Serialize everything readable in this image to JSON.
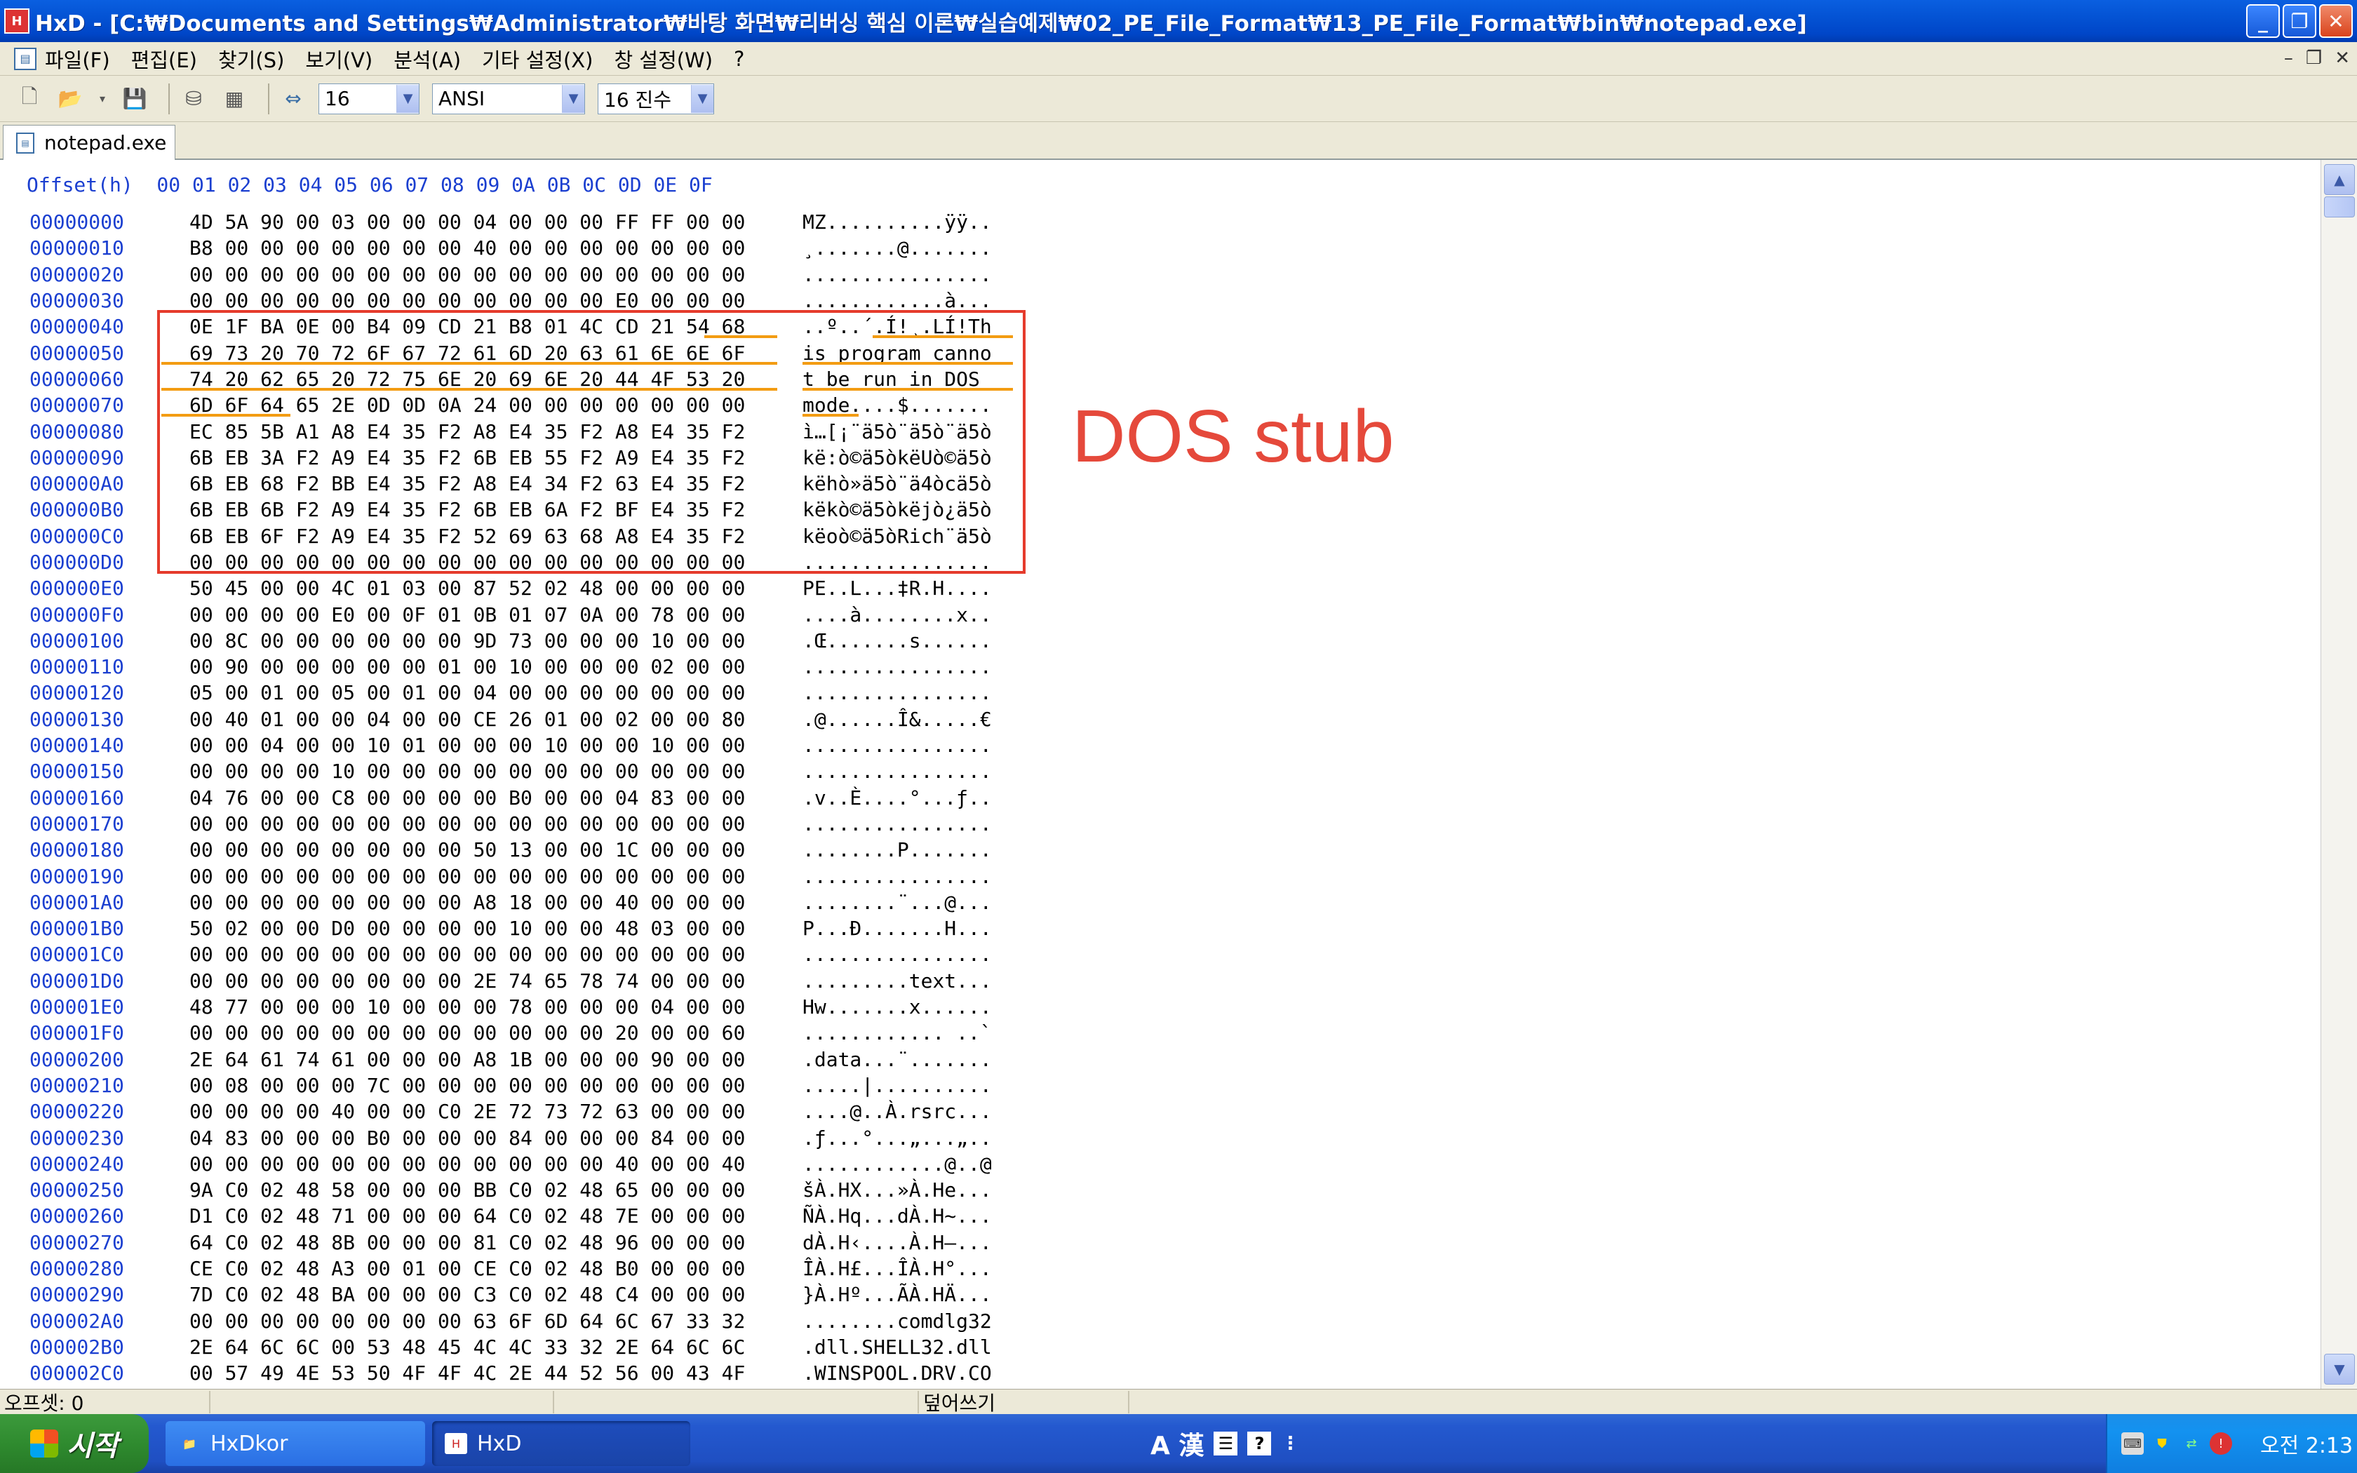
{
  "window": {
    "title": "HxD - [C:₩Documents and Settings₩Administrator₩바탕 화면₩리버싱 핵심 이론₩실습예제₩02_PE_File_Format₩13_PE_File_Format₩bin₩notepad.exe]",
    "app_icon_label": "H"
  },
  "menu": {
    "items": [
      "파일(F)",
      "편집(E)",
      "찾기(S)",
      "보기(V)",
      "분석(A)",
      "기타 설정(X)",
      "창 설정(W)",
      "?"
    ]
  },
  "toolbar": {
    "bytes_per_row": "16",
    "charset": "ANSI",
    "offset_base": "16 진수"
  },
  "tab": {
    "label": "notepad.exe"
  },
  "hex_header": "Offset(h)  00 01 02 03 04 05 06 07 08 09 0A 0B 0C 0D 0E 0F",
  "rows": [
    {
      "off": "00000000",
      "hex": "4D 5A 90 00 03 00 00 00 04 00 00 00 FF FF 00 00",
      "asc": "MZ..........ÿÿ.."
    },
    {
      "off": "00000010",
      "hex": "B8 00 00 00 00 00 00 00 40 00 00 00 00 00 00 00",
      "asc": "¸.......@......."
    },
    {
      "off": "00000020",
      "hex": "00 00 00 00 00 00 00 00 00 00 00 00 00 00 00 00",
      "asc": "................"
    },
    {
      "off": "00000030",
      "hex": "00 00 00 00 00 00 00 00 00 00 00 00 E0 00 00 00",
      "asc": "............à..."
    },
    {
      "off": "00000040",
      "hex": "0E 1F BA 0E 00 B4 09 CD 21 B8 01 4C CD 21 54 68",
      "asc": "..º..´.Í!¸.LÍ!Th"
    },
    {
      "off": "00000050",
      "hex": "69 73 20 70 72 6F 67 72 61 6D 20 63 61 6E 6E 6F",
      "asc": "is program canno"
    },
    {
      "off": "00000060",
      "hex": "74 20 62 65 20 72 75 6E 20 69 6E 20 44 4F 53 20",
      "asc": "t be run in DOS "
    },
    {
      "off": "00000070",
      "hex": "6D 6F 64 65 2E 0D 0D 0A 24 00 00 00 00 00 00 00",
      "asc": "mode....$......."
    },
    {
      "off": "00000080",
      "hex": "EC 85 5B A1 A8 E4 35 F2 A8 E4 35 F2 A8 E4 35 F2",
      "asc": "ì…[¡¨ä5ò¨ä5ò¨ä5ò"
    },
    {
      "off": "00000090",
      "hex": "6B EB 3A F2 A9 E4 35 F2 6B EB 55 F2 A9 E4 35 F2",
      "asc": "kë:ò©ä5òkëUò©ä5ò"
    },
    {
      "off": "000000A0",
      "hex": "6B EB 68 F2 BB E4 35 F2 A8 E4 34 F2 63 E4 35 F2",
      "asc": "këhò»ä5ò¨ä4òcä5ò"
    },
    {
      "off": "000000B0",
      "hex": "6B EB 6B F2 A9 E4 35 F2 6B EB 6A F2 BF E4 35 F2",
      "asc": "këkò©ä5òkëjò¿ä5ò"
    },
    {
      "off": "000000C0",
      "hex": "6B EB 6F F2 A9 E4 35 F2 52 69 63 68 A8 E4 35 F2",
      "asc": "këoò©ä5òRich¨ä5ò"
    },
    {
      "off": "000000D0",
      "hex": "00 00 00 00 00 00 00 00 00 00 00 00 00 00 00 00",
      "asc": "................"
    },
    {
      "off": "000000E0",
      "hex": "50 45 00 00 4C 01 03 00 87 52 02 48 00 00 00 00",
      "asc": "PE..L...‡R.H...."
    },
    {
      "off": "000000F0",
      "hex": "00 00 00 00 E0 00 0F 01 0B 01 07 0A 00 78 00 00",
      "asc": "....à........x.."
    },
    {
      "off": "00000100",
      "hex": "00 8C 00 00 00 00 00 00 9D 73 00 00 00 10 00 00",
      "asc": ".Œ.......s......"
    },
    {
      "off": "00000110",
      "hex": "00 90 00 00 00 00 00 01 00 10 00 00 00 02 00 00",
      "asc": "................"
    },
    {
      "off": "00000120",
      "hex": "05 00 01 00 05 00 01 00 04 00 00 00 00 00 00 00",
      "asc": "................"
    },
    {
      "off": "00000130",
      "hex": "00 40 01 00 00 04 00 00 CE 26 01 00 02 00 00 80",
      "asc": ".@......Î&.....€"
    },
    {
      "off": "00000140",
      "hex": "00 00 04 00 00 10 01 00 00 00 10 00 00 10 00 00",
      "asc": "................"
    },
    {
      "off": "00000150",
      "hex": "00 00 00 00 10 00 00 00 00 00 00 00 00 00 00 00",
      "asc": "................"
    },
    {
      "off": "00000160",
      "hex": "04 76 00 00 C8 00 00 00 00 B0 00 00 04 83 00 00",
      "asc": ".v..È....°...ƒ.."
    },
    {
      "off": "00000170",
      "hex": "00 00 00 00 00 00 00 00 00 00 00 00 00 00 00 00",
      "asc": "................"
    },
    {
      "off": "00000180",
      "hex": "00 00 00 00 00 00 00 00 50 13 00 00 1C 00 00 00",
      "asc": "........P......."
    },
    {
      "off": "00000190",
      "hex": "00 00 00 00 00 00 00 00 00 00 00 00 00 00 00 00",
      "asc": "................"
    },
    {
      "off": "000001A0",
      "hex": "00 00 00 00 00 00 00 00 A8 18 00 00 40 00 00 00",
      "asc": "........¨...@..."
    },
    {
      "off": "000001B0",
      "hex": "50 02 00 00 D0 00 00 00 00 10 00 00 48 03 00 00",
      "asc": "P...Ð.......H..."
    },
    {
      "off": "000001C0",
      "hex": "00 00 00 00 00 00 00 00 00 00 00 00 00 00 00 00",
      "asc": "................"
    },
    {
      "off": "000001D0",
      "hex": "00 00 00 00 00 00 00 00 2E 74 65 78 74 00 00 00",
      "asc": ".........text..."
    },
    {
      "off": "000001E0",
      "hex": "48 77 00 00 00 10 00 00 00 78 00 00 00 04 00 00",
      "asc": "Hw.......x......"
    },
    {
      "off": "000001F0",
      "hex": "00 00 00 00 00 00 00 00 00 00 00 00 20 00 00 60",
      "asc": "............ ..`"
    },
    {
      "off": "00000200",
      "hex": "2E 64 61 74 61 00 00 00 A8 1B 00 00 00 90 00 00",
      "asc": ".data...¨......."
    },
    {
      "off": "00000210",
      "hex": "00 08 00 00 00 7C 00 00 00 00 00 00 00 00 00 00",
      "asc": ".....|.........."
    },
    {
      "off": "00000220",
      "hex": "00 00 00 00 40 00 00 C0 2E 72 73 72 63 00 00 00",
      "asc": "....@..À.rsrc..."
    },
    {
      "off": "00000230",
      "hex": "04 83 00 00 00 B0 00 00 00 84 00 00 00 84 00 00",
      "asc": ".ƒ...°...„...„.."
    },
    {
      "off": "00000240",
      "hex": "00 00 00 00 00 00 00 00 00 00 00 00 40 00 00 40",
      "asc": "............@..@"
    },
    {
      "off": "00000250",
      "hex": "9A C0 02 48 58 00 00 00 BB C0 02 48 65 00 00 00",
      "asc": "šÀ.HX...»À.He..."
    },
    {
      "off": "00000260",
      "hex": "D1 C0 02 48 71 00 00 00 64 C0 02 48 7E 00 00 00",
      "asc": "ÑÀ.Hq...dÀ.H~..."
    },
    {
      "off": "00000270",
      "hex": "64 C0 02 48 8B 00 00 00 81 C0 02 48 96 00 00 00",
      "asc": "dÀ.H‹....À.H–..."
    },
    {
      "off": "00000280",
      "hex": "CE C0 02 48 A3 00 01 00 CE C0 02 48 B0 00 00 00",
      "asc": "ÎÀ.H£...ÎÀ.H°..."
    },
    {
      "off": "00000290",
      "hex": "7D C0 02 48 BA 00 00 00 C3 C0 02 48 C4 00 00 00",
      "asc": "}À.Hº...ÃÀ.HÄ..."
    },
    {
      "off": "000002A0",
      "hex": "00 00 00 00 00 00 00 00 63 6F 6D 64 6C 67 33 32",
      "asc": "........comdlg32"
    },
    {
      "off": "000002B0",
      "hex": "2E 64 6C 6C 00 53 48 45 4C 4C 33 32 2E 64 6C 6C",
      "asc": ".dll.SHELL32.dll"
    },
    {
      "off": "000002C0",
      "hex": "00 57 49 4E 53 50 4F 4F 4C 2E 44 52 56 00 43 4F",
      "asc": ".WINSPOOL.DRV.CO"
    }
  ],
  "annotation": {
    "label": "DOS stub",
    "box_color": "#e53b2c",
    "underline_color": "#f39c12"
  },
  "status": {
    "offset": "오프셋: 0",
    "mode": "덮어쓰기"
  },
  "taskbar": {
    "start_label": "시작",
    "tasks": [
      {
        "label": "HxDkor",
        "icon": "folder-icon"
      },
      {
        "label": "HxD",
        "icon": "hxd-icon"
      }
    ],
    "lang_label": "A 漢",
    "clock": "오전 2:13"
  }
}
